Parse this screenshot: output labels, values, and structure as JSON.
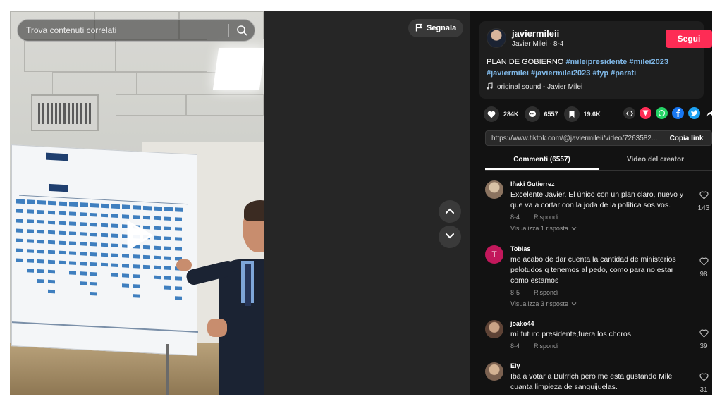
{
  "search": {
    "placeholder": "Trova contenuti correlati"
  },
  "report": {
    "label": "Segnala"
  },
  "author": {
    "username": "javiermileii",
    "display_name": "Javier Milei",
    "date": "8-4",
    "follow_label": "Segui",
    "caption_prefix": "PLAN DE GOBIERNO",
    "hashtags": [
      "#mileipresidente",
      "#milei2023",
      "#javiermilei",
      "#javiermilei2023",
      "#fyp",
      "#parati"
    ],
    "sound": "original sound - Javier Milei"
  },
  "stats": {
    "likes": "284K",
    "comments": "6557",
    "saves": "19.6K"
  },
  "share": {
    "link": "https://www.tiktok.com/@javiermileii/video/7263582...",
    "copy_label": "Copia link"
  },
  "tabs": {
    "comments": "Commenti (6557)",
    "creator_videos": "Video del creator"
  },
  "comments": [
    {
      "user": "Iñaki Gutierrez",
      "text": "Excelente Javier. El único con un plan claro, nuevo y que va a cortar con la joda de la política sos vos.",
      "date": "8-4",
      "reply": "Rispondi",
      "replies": "Visualizza 1 risposta",
      "likes": "143",
      "avatar_color": "#b79a7e"
    },
    {
      "user": "Tobias",
      "text": "me acabo de dar cuenta la cantidad de ministerios pelotudos q tenemos al pedo, como para no estar como estamos",
      "date": "8-5",
      "reply": "Rispondi",
      "replies": "Visualizza 3 risposte",
      "likes": "98",
      "avatar_letter": "T",
      "avatar_color": "#c2185b"
    },
    {
      "user": "joako44",
      "text": "mí futuro presidente,fuera los choros",
      "date": "8-4",
      "reply": "Rispondi",
      "replies": "",
      "likes": "39",
      "avatar_color": "#7a5b4c"
    },
    {
      "user": "Ely",
      "text": "Iba a votar a Bulrrich pero me esta gustando Milei cuanta limpieza de sanguijuelas.",
      "date": "",
      "reply": "",
      "replies": "",
      "likes": "31",
      "avatar_color": "#a4826a"
    }
  ],
  "colors": {
    "accent": "#fe2c55",
    "hashtag": "#7fb7e6",
    "panel_bg": "#121212"
  }
}
